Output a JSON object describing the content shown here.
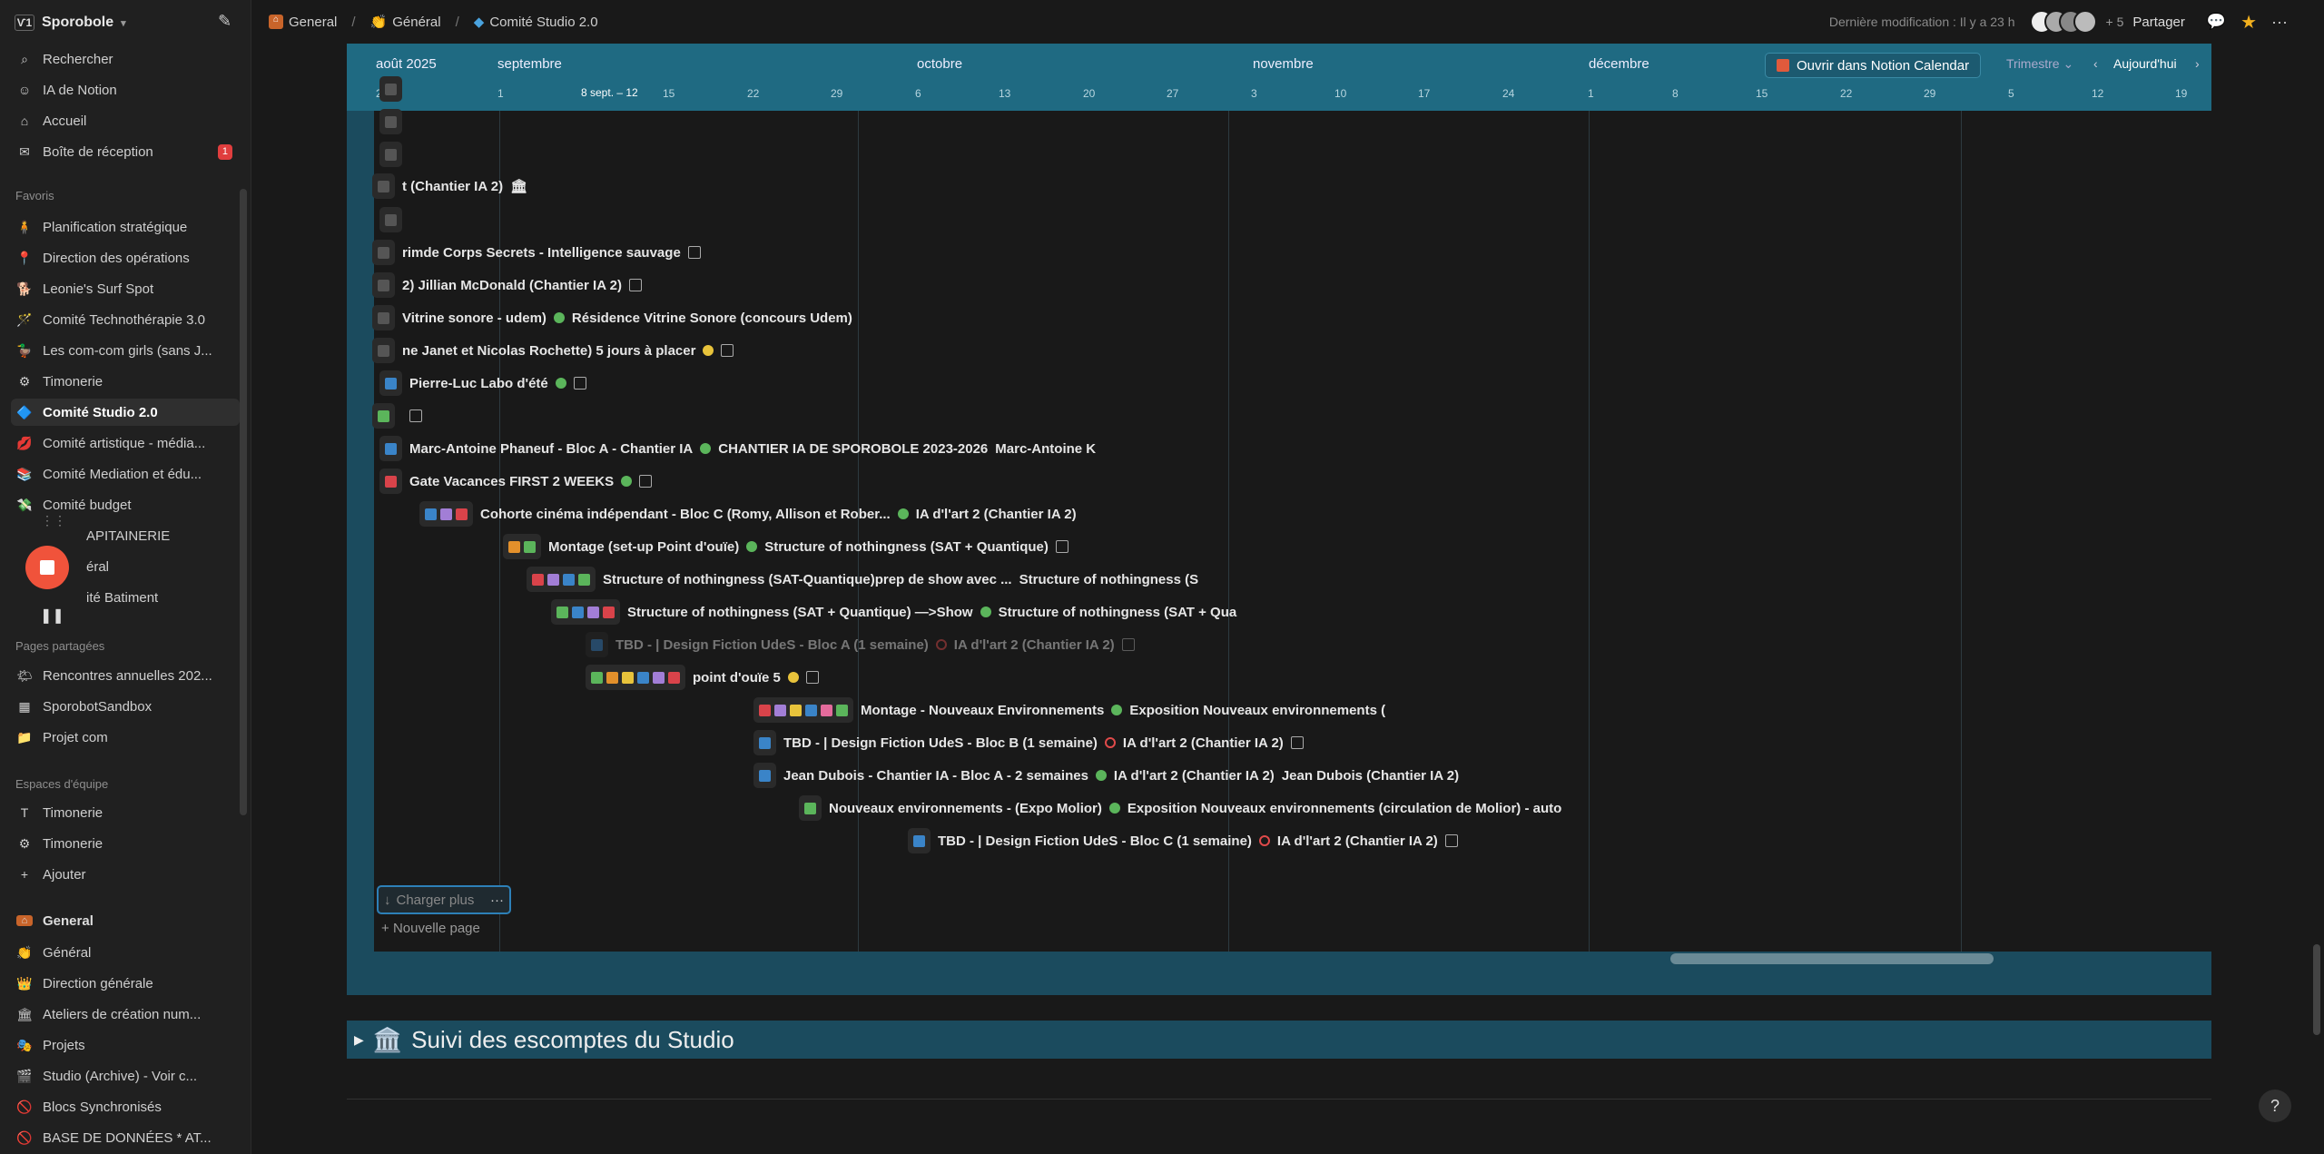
{
  "sidebar": {
    "workspace": "Sporobole",
    "nav": [
      {
        "label": "Rechercher",
        "icon": "search-icon"
      },
      {
        "label": "IA de Notion",
        "icon": "ai-icon"
      },
      {
        "label": "Accueil",
        "icon": "home-icon"
      },
      {
        "label": "Boîte de réception",
        "icon": "inbox-icon",
        "badge": "1"
      }
    ],
    "favoris_title": "Favoris",
    "favoris": [
      {
        "label": "Planification stratégique",
        "icon": "🧍"
      },
      {
        "label": "Direction des opérations",
        "icon": "📍"
      },
      {
        "label": "Leonie's Surf Spot",
        "icon": "🐕"
      },
      {
        "label": "Comité Technothérapie 3.0",
        "icon": "🪄"
      },
      {
        "label": "Les com-com girls (sans J...",
        "icon": "🦆"
      },
      {
        "label": "Timonerie",
        "icon": "⚙"
      },
      {
        "label": "Comité Studio 2.0",
        "icon": "🔷",
        "active": true
      },
      {
        "label": "Comité artistique - média...",
        "icon": "💋"
      },
      {
        "label": "Comité Mediation et édu...",
        "icon": "📚"
      },
      {
        "label": "Comité budget",
        "icon": "💸"
      },
      {
        "label": "APITAINERIE",
        "icon": ""
      },
      {
        "label": "éral",
        "icon": ""
      },
      {
        "label": "ité Batiment",
        "icon": ""
      }
    ],
    "shared_title": "Pages partagées",
    "shared": [
      {
        "label": "Rencontres annuelles 202...",
        "icon": "🌤"
      },
      {
        "label": "SporobotSandbox",
        "icon": "▦"
      },
      {
        "label": "Projet com",
        "icon": "📁"
      }
    ],
    "team_title": "Espaces d'équipe",
    "team": [
      {
        "label": "Timonerie",
        "icon": "T"
      },
      {
        "label": "Timonerie",
        "icon": "⚙"
      },
      {
        "label": "Ajouter",
        "icon": "+"
      }
    ],
    "general_title": "General",
    "general": [
      {
        "label": "Général",
        "icon": "👏"
      },
      {
        "label": "Direction générale",
        "icon": "👑"
      },
      {
        "label": "Ateliers de création num...",
        "icon": "🏛"
      },
      {
        "label": "Projets",
        "icon": "🎭"
      },
      {
        "label": "Studio (Archive) - Voir c...",
        "icon": "🎬"
      },
      {
        "label": "Blocs Synchronisés",
        "icon": "🚫"
      },
      {
        "label": "BASE DE DONNÉES * AT...",
        "icon": "🚫"
      }
    ]
  },
  "topbar": {
    "crumbs": [
      "General",
      "Général",
      "Comité Studio 2.0"
    ],
    "last_modified": "Dernière modification : Il y a 23 h",
    "extra_count": "+ 5",
    "share": "Partager"
  },
  "timeline": {
    "months": [
      "août 2025",
      "septembre",
      "octobre",
      "novembre",
      "décembre"
    ],
    "days": [
      "25",
      "1",
      "15",
      "22",
      "29",
      "6",
      "13",
      "20",
      "27",
      "3",
      "10",
      "17",
      "24",
      "1",
      "8",
      "15",
      "22",
      "29",
      "5",
      "12",
      "19"
    ],
    "range_label": "8 sept. – 12",
    "open_calendar": "Ouvrir dans Notion Calendar",
    "period": "Trimestre",
    "today": "Aujourd'hui",
    "rows": [
      {
        "text": "",
        "y": 0
      },
      {
        "text": "",
        "y": 0
      },
      {
        "text": "",
        "y": 0
      },
      {
        "text": "t (Chantier IA 2)",
        "y": 0
      },
      {
        "text": "",
        "y": 0
      },
      {
        "text": "rimde Corps Secrets - Intelligence sauvage",
        "y": 0
      },
      {
        "text": "2)  Jillian McDonald (Chantier IA 2)",
        "y": 0
      },
      {
        "text": "Vitrine sonore - udem)",
        "extra": "Résidence Vitrine Sonore (concours Udem)"
      },
      {
        "text": "ne Janet et Nicolas Rochette) 5 jours à placer"
      },
      {
        "text": "Pierre-Luc Labo d'été"
      },
      {
        "text": ""
      },
      {
        "text": "Marc-Antoine Phaneuf - Bloc A - Chantier IA",
        "extra": "CHANTIER IA DE SPOROBOLE 2023-2026",
        "extra2": "Marc-Antoine K"
      },
      {
        "text": "Gate Vacances FIRST 2 WEEKS"
      },
      {
        "text": "Cohorte cinéma indépendant - Bloc C (Romy, Allison et Rober...",
        "extra": "IA d'l'art 2 (Chantier IA 2)"
      },
      {
        "text": "Montage (set-up Point d'ouïe)",
        "extra": "Structure of nothingness (SAT + Quantique)"
      },
      {
        "text": "Structure of nothingness (SAT-Quantique)prep de show avec ...",
        "extra": "Structure of nothingness (S"
      },
      {
        "text": "Structure of nothingness (SAT + Quantique) —>Show",
        "extra": "Structure of nothingness (SAT + Qua"
      },
      {
        "text": "TBD - | Design Fiction UdeS - Bloc A (1 semaine)",
        "extra": "IA d'l'art 2 (Chantier IA 2)"
      },
      {
        "text": "point d'ouïe 5"
      },
      {
        "text": "Montage - Nouveaux Environnements",
        "extra": "Exposition Nouveaux environnements ("
      },
      {
        "text": "TBD - | Design Fiction UdeS - Bloc B (1 semaine)",
        "extra": "IA d'l'art 2 (Chantier IA 2)"
      },
      {
        "text": "Jean Dubois - Chantier IA - Bloc A - 2 semaines",
        "extra": "IA d'l'art 2 (Chantier IA 2)",
        "extra2": "Jean Dubois (Chantier IA 2)"
      },
      {
        "text": "Nouveaux environnements - (Expo Molior)",
        "extra": "Exposition Nouveaux environnements (circulation de Molior) - auto"
      },
      {
        "text": "TBD - | Design Fiction UdeS - Bloc C (1 semaine)",
        "extra": "IA d'l'art 2 (Chantier IA 2)"
      }
    ],
    "load_more": "Charger plus",
    "new_page": "Nouvelle page"
  },
  "section": {
    "icon": "🏛️",
    "title": "Suivi des escomptes du Studio"
  },
  "colors": {
    "accent": "#2d80b8",
    "timeline_bg": "#1b4b5e",
    "header_bg": "#1f6a82",
    "badge": "#e03e3e",
    "record": "#f0533b"
  }
}
